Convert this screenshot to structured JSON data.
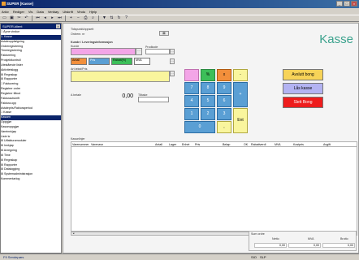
{
  "window": {
    "title": "SUPER [Kasse]"
  },
  "menu": [
    "Arkiv",
    "Rediger",
    "Vis",
    "Data",
    "Verktøy",
    "Utskrift",
    "Vindu",
    "Hjelp"
  ],
  "toolbar": {
    "icons": [
      "new-icon",
      "save-icon",
      "cut-icon",
      "undo-icon",
      "first-icon",
      "prev-icon",
      "next-icon",
      "last-icon",
      "add-icon",
      "delete-icon",
      "print-icon",
      "preview-icon",
      "filter-icon",
      "sort-icon",
      "refresh-icon",
      "help-icon"
    ]
  },
  "sidebar": {
    "header": "SUPER-klient",
    "items": [
      "□ Åpne vindue",
      "    1. Kasse",
      "Avtaleoppfølgning",
      "Ordreregistrering",
      "Timeregistrering",
      "Fakturering",
      "Prosjektkontroll",
      "Utestående lister",
      "Aktivitetslogg",
      "⊞ Regnskap",
      "⊞ Rapporter",
      "□ Fakturering",
      "    Registrer ordre",
      "    Registrer tilbud",
      "    Fakturautskrift",
      "    Faktura.opp",
      "    Avtalepris/Fakturaperiod",
      "    □ Kasse",
      "        Kassen",
      "        Oppgjør",
      "        Kasseoppgjør",
      "    Vareinnkjøp",
      "    Liste kr",
      "⊞ Utfakturamoduler",
      "⊞ Innkjøp",
      "⊞ Avregning",
      "⊞ Time",
      "⊞ Regnskap",
      "⊞ Rapporter",
      "⊞ Datalogging",
      "⊞ Systemadministrasjon",
      "Kommentarlog"
    ]
  },
  "main": {
    "title": "Kasse",
    "section_time_label": "Tidspunkt/oppsett",
    "order_nr_label": "Ordrenr. nr",
    "section_items_label": "Kunde / Leveringsinformasjon",
    "kunde_label": "Kunde",
    "kunde_value": "",
    "prodcode_label": "Prodkode",
    "antall_label": "Antall",
    "pris_label": "Pris",
    "rabatt_label": "Rabatt(%)",
    "mva_label": "MVA",
    "artikkel_label": "Art.tekst/Pris",
    "amount_label": "A betale",
    "amount_value": "0,00",
    "change_label": "Tilbake",
    "keypad": {
      "row1": [
        "",
        "%",
        "x",
        "-"
      ],
      "row2": [
        "7",
        "8",
        "9"
      ],
      "row3": [
        "4",
        "5",
        "6"
      ],
      "row4": [
        "1",
        "2",
        "3"
      ],
      "row5": [
        "0",
        ","
      ],
      "plus": "+",
      "enter": "Ent"
    },
    "actions": {
      "avslutt": "Avslutt bong",
      "las_kasse": "Lås kasse",
      "slett_bong": "Slett Bong"
    },
    "table_section_label": "Kasselinjer",
    "columns": [
      "Varenummer",
      "Varenavn",
      "Antall",
      "Lager",
      "Enhet",
      "Pris",
      "Beløp",
      "OK",
      "Rabattverdi",
      "MVA",
      "Kostpris",
      "Avgift"
    ],
    "summary": {
      "label": "Sum ordre",
      "headers": [
        "Netto",
        "MVA",
        "Brutto"
      ],
      "values": [
        "0,00",
        "0,00",
        "0,00"
      ]
    }
  },
  "status": {
    "left": "F9 Sendepørs",
    "mid": "SIO",
    "right": "SLP"
  },
  "colors": {
    "title_green": "#3ba28d",
    "key_blue": "#5a9fd4",
    "key_pink": "#f3a5e7",
    "key_green": "#3cbf59",
    "key_orange": "#f28f3b",
    "key_yellow": "#f9f59d",
    "avslutt": "#f7d358",
    "las": "#b3b3f2",
    "slett": "#ee1c1c"
  }
}
